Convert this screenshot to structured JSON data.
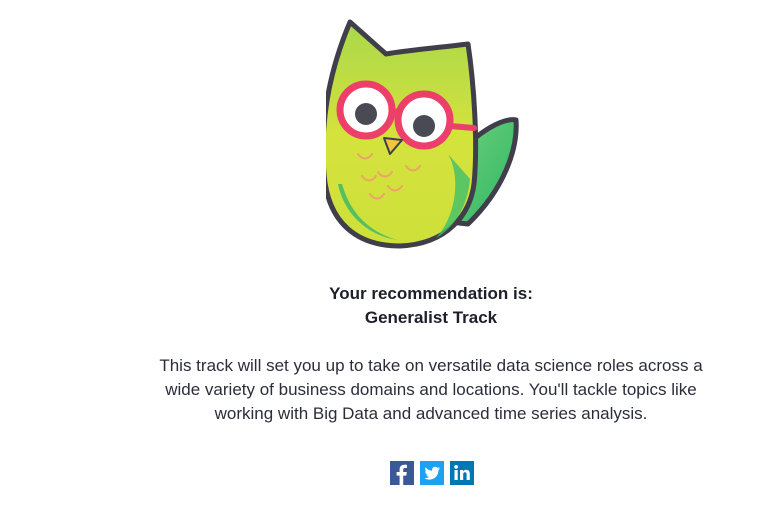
{
  "result": {
    "heading": "Your recommendation is:",
    "track_name": "Generalist Track",
    "description": "This track will set you up to take on versatile data science roles across a wide variety of business domains and locations. You'll tackle topics like working with Big Data and advanced time series analysis."
  },
  "share": {
    "buttons": [
      {
        "icon": "facebook-icon",
        "color": "#3b5998"
      },
      {
        "icon": "twitter-icon",
        "color": "#1da1f2"
      },
      {
        "icon": "linkedin-icon",
        "color": "#0077b5"
      }
    ]
  },
  "colors": {
    "owl_body": "#d4e23c",
    "owl_wing": "#4cc75a",
    "owl_outline": "#3f3e4a",
    "glasses": "#ec3f6a"
  }
}
